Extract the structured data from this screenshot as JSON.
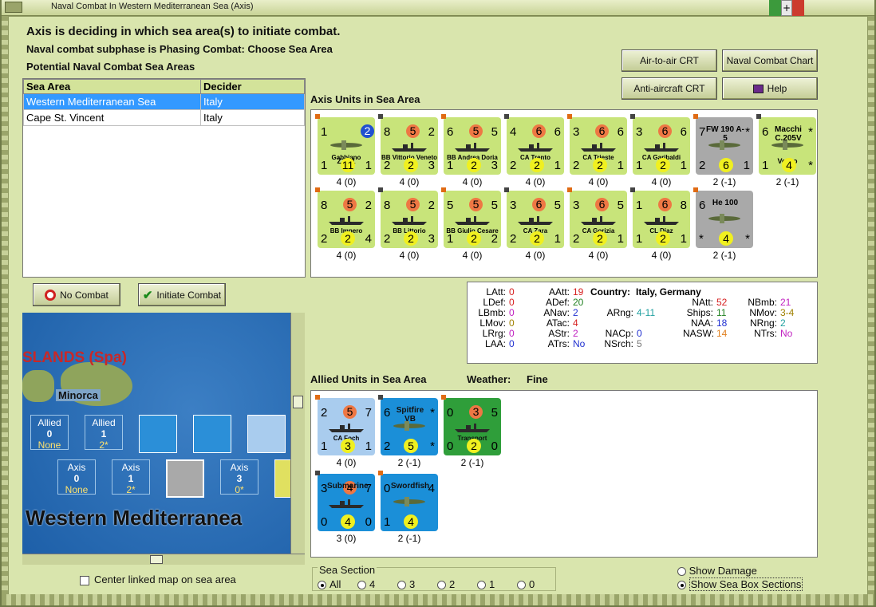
{
  "window": {
    "title": "Naval Combat In Western Mediterranean Sea (Axis)"
  },
  "header": {
    "line1": "Axis is deciding in which sea area(s) to initiate combat.",
    "line2": "Naval combat subphase is Phasing Combat: Choose Sea Area",
    "line3": "Potential Naval Combat Sea Areas"
  },
  "buttons": {
    "air_to_air": "Air-to-air CRT",
    "naval_chart": "Naval Combat Chart",
    "anti_aircraft": "Anti-aircraft CRT",
    "help": "Help",
    "no_combat": "No Combat",
    "initiate": "Initiate Combat"
  },
  "sea_table": {
    "headers": [
      "Sea Area",
      "Decider"
    ],
    "rows": [
      {
        "area": "Western Mediterranean Sea",
        "decider": "Italy"
      },
      {
        "area": "Cape St. Vincent",
        "decider": "Italy"
      }
    ]
  },
  "axis_section": {
    "title": "Axis Units in Sea Area"
  },
  "axis_units": [
    {
      "a": "1",
      "d": "2",
      "m": "",
      "name": "Gabbiano",
      "bl": "1",
      "bc": "11",
      "br": "1",
      "sub": "Z.501",
      "cap": "4 (0)",
      "type": "air-special"
    },
    {
      "a": "8",
      "d": "5",
      "m": "2",
      "name": "BB Vittorio Veneto",
      "bl": "2",
      "bc": "2",
      "br": "3",
      "cap": "4 (0)"
    },
    {
      "a": "6",
      "d": "5",
      "m": "5",
      "name": "BB Andrea Doria",
      "bl": "1",
      "bc": "2",
      "br": "3",
      "cap": "4 (0)"
    },
    {
      "a": "4",
      "d": "6",
      "m": "6",
      "name": "CA Trento",
      "bl": "2",
      "bc": "2",
      "br": "1",
      "cap": "4 (0)"
    },
    {
      "a": "3",
      "d": "6",
      "m": "6",
      "name": "CA Trieste",
      "bl": "2",
      "bc": "2",
      "br": "1",
      "cap": "4 (0)"
    },
    {
      "a": "3",
      "d": "6",
      "m": "6",
      "name": "CA Garibaldi",
      "bl": "1",
      "bc": "2",
      "br": "1",
      "cap": "4 (0)"
    },
    {
      "a": "7",
      "d": "",
      "m": "*",
      "name": "FW 190 A-5",
      "bl": "2",
      "bc": "6",
      "br": "1",
      "cap": "2 (-1)",
      "type": "air-grey"
    },
    {
      "a": "6",
      "d": "",
      "m": "*",
      "name": "Macchi C.205V",
      "sub": "Veltro",
      "bl": "1",
      "bc": "4",
      "br": "*",
      "cap": "2 (-1)",
      "type": "air"
    },
    {
      "a": "8",
      "d": "5",
      "m": "2",
      "name": "BB Impero",
      "bl": "2",
      "bc": "2",
      "br": "4",
      "cap": "4 (0)"
    },
    {
      "a": "8",
      "d": "5",
      "m": "2",
      "name": "BB Littorio",
      "bl": "2",
      "bc": "2",
      "br": "3",
      "cap": "4 (0)"
    },
    {
      "a": "5",
      "d": "5",
      "m": "5",
      "name": "BB Giulio Cesare",
      "bl": "1",
      "bc": "2",
      "br": "2",
      "cap": "4 (0)"
    },
    {
      "a": "3",
      "d": "6",
      "m": "5",
      "name": "CA Zara",
      "bl": "2",
      "bc": "2",
      "br": "1",
      "cap": "4 (0)"
    },
    {
      "a": "3",
      "d": "6",
      "m": "5",
      "name": "CA Gorizia",
      "bl": "2",
      "bc": "2",
      "br": "1",
      "cap": "4 (0)"
    },
    {
      "a": "1",
      "d": "6",
      "m": "8",
      "name": "CL Diaz",
      "bl": "1",
      "bc": "2",
      "br": "1",
      "cap": "4 (0)"
    },
    {
      "a": "6",
      "d": "",
      "m": "",
      "name": "He 100",
      "bl": "*",
      "bc": "4",
      "br": "*",
      "cap": "2 (-1)",
      "type": "air-grey"
    }
  ],
  "stats": {
    "country_label": "Country:",
    "country": "Italy, Germany",
    "items": [
      {
        "k": "LAtt:",
        "v": "0",
        "c": "#d62020"
      },
      {
        "k": "LDef:",
        "v": "0",
        "c": "#d62020"
      },
      {
        "k": "LBmb:",
        "v": "0",
        "c": "#c020c0"
      },
      {
        "k": "LMov:",
        "v": "0",
        "c": "#a08000"
      },
      {
        "k": "LRrg:",
        "v": "0",
        "c": "#c020c0"
      },
      {
        "k": "LAA:",
        "v": "0",
        "c": "#2030d0"
      },
      {
        "k": "AAtt:",
        "v": "19",
        "c": "#d62020"
      },
      {
        "k": "ADef:",
        "v": "20",
        "c": "#208020"
      },
      {
        "k": "ANav:",
        "v": "2",
        "c": "#2030d0"
      },
      {
        "k": "ATac:",
        "v": "4",
        "c": "#d62020"
      },
      {
        "k": "AStr:",
        "v": "2",
        "c": "#c020c0"
      },
      {
        "k": "ATrs:",
        "v": "No",
        "c": "#2030d0"
      },
      {
        "k": "ARng:",
        "v": "4-11",
        "c": "#20a0a0"
      },
      {
        "k": "NACp:",
        "v": "0",
        "c": "#2030d0"
      },
      {
        "k": "NSrch:",
        "v": "5",
        "c": "#777"
      },
      {
        "k": "NAtt:",
        "v": "52",
        "c": "#d62020"
      },
      {
        "k": "Ships:",
        "v": "11",
        "c": "#208020"
      },
      {
        "k": "NAA:",
        "v": "18",
        "c": "#2030d0"
      },
      {
        "k": "NASW:",
        "v": "14",
        "c": "#e08020"
      },
      {
        "k": "NBmb:",
        "v": "21",
        "c": "#c020c0"
      },
      {
        "k": "NMov:",
        "v": "3-4",
        "c": "#a08000"
      },
      {
        "k": "NRng:",
        "v": "2",
        "c": "#20a0a0"
      },
      {
        "k": "NTrs:",
        "v": "No",
        "c": "#c020c0"
      }
    ]
  },
  "allied_section": {
    "title": "Allied Units in Sea Area",
    "weather_label": "Weather:",
    "weather": "Fine"
  },
  "allied_units": [
    {
      "a": "2",
      "d": "5",
      "m": "7",
      "name": "CA Foch",
      "bl": "1",
      "bc": "3",
      "br": "1",
      "cap": "4 (0)",
      "type": "blue"
    },
    {
      "a": "6",
      "d": "",
      "m": "*",
      "name": "Spitfire VB",
      "bl": "2",
      "bc": "5",
      "br": "*",
      "cap": "2 (-1)",
      "type": "dblue"
    },
    {
      "a": "0",
      "d": "3",
      "m": "5",
      "name": "Transport",
      "bl": "0",
      "bc": "2",
      "br": "0",
      "cap": "2 (-1)",
      "type": "green"
    },
    {
      "a": "3",
      "d": "4",
      "m": "7",
      "name": "Submarine",
      "bl": "0",
      "bc": "4",
      "br": "0",
      "cap": "3 (0)",
      "type": "dblue"
    },
    {
      "a": "0",
      "d": "",
      "m": "4",
      "name": "Swordfish",
      "bl": "1",
      "bc": "4",
      "br": "",
      "cap": "2 (-1)",
      "type": "dblue"
    }
  ],
  "map": {
    "region": "SLANDS (Spa)",
    "island": "Minorca",
    "sea": "Western Mediterranea",
    "allied_boxes": [
      {
        "l": "Allied",
        "n": "0",
        "s": "None"
      },
      {
        "l": "Allied",
        "n": "1",
        "s": "2*"
      }
    ],
    "axis_boxes": [
      {
        "l": "Axis",
        "n": "0",
        "s": "None"
      },
      {
        "l": "Axis",
        "n": "1",
        "s": "2*"
      },
      {
        "l": "Axis",
        "n": "3",
        "s": "0*"
      }
    ],
    "counter_labels": [
      "3",
      "3",
      "3"
    ]
  },
  "center_linked": "Center linked map on sea area",
  "sea_section": {
    "label": "Sea Section",
    "options": [
      "All",
      "4",
      "3",
      "2",
      "1",
      "0"
    ],
    "selected": "All"
  },
  "options": {
    "show_damage": "Show Damage",
    "show_boxes": "Show Sea Box Sections"
  }
}
